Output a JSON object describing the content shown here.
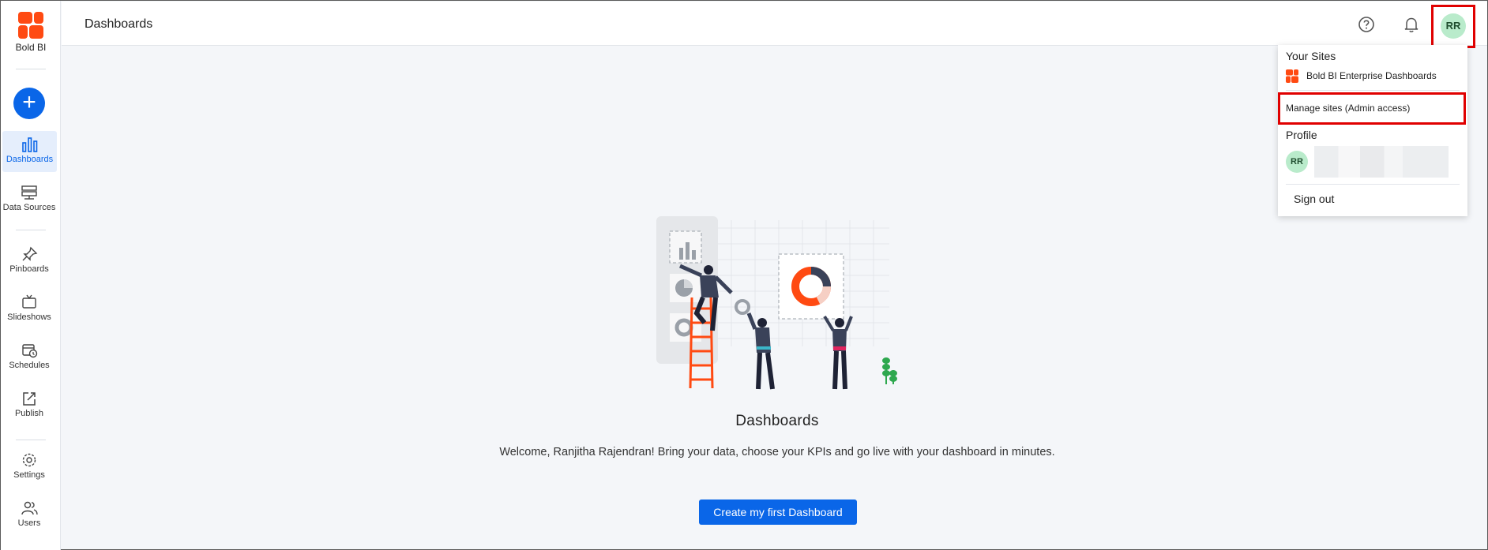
{
  "app": {
    "logo_text": "Bold BI",
    "accent": "#0a66e8"
  },
  "sidebar": {
    "create_label": "+",
    "items": [
      {
        "label": "Dashboards",
        "icon": "bar-chart-icon",
        "active": true
      },
      {
        "label": "Data Sources",
        "icon": "database-icon"
      },
      {
        "label": "Pinboards",
        "icon": "pin-icon"
      },
      {
        "label": "Slideshows",
        "icon": "tv-icon"
      },
      {
        "label": "Schedules",
        "icon": "calendar-clock-icon"
      },
      {
        "label": "Publish",
        "icon": "publish-icon"
      },
      {
        "label": "Settings",
        "icon": "gear-icon"
      },
      {
        "label": "Users",
        "icon": "users-icon"
      }
    ]
  },
  "header": {
    "title": "Dashboards",
    "help_icon": "help-circle-icon",
    "bell_icon": "bell-icon",
    "avatar_initials": "RR"
  },
  "dropdown": {
    "sites_heading": "Your Sites",
    "site_name": "Bold BI Enterprise Dashboards",
    "manage_sites": "Manage sites (Admin access)",
    "profile_heading": "Profile",
    "profile_initials": "RR",
    "sign_out": "Sign out"
  },
  "main": {
    "empty_title": "Dashboards",
    "empty_description": "Welcome, Ranjitha Rajendran! Bring your data, choose your KPIs and go live with your dashboard in minutes.",
    "create_button": "Create my first Dashboard"
  }
}
